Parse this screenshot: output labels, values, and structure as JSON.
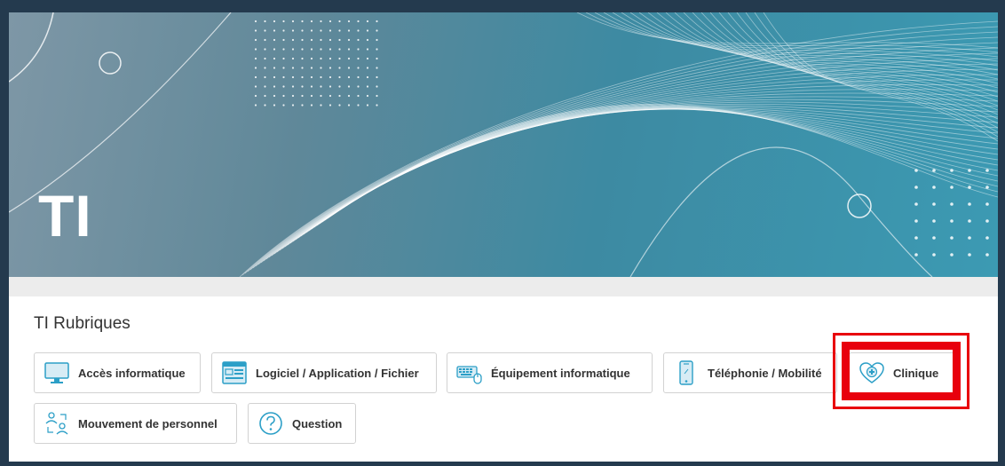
{
  "hero": {
    "title": "TI"
  },
  "rubriques": {
    "title": "TI Rubriques",
    "items": [
      {
        "label": "Accès informatique",
        "icon": "monitor-icon"
      },
      {
        "label": "Logiciel / Application / Fichier",
        "icon": "application-window-icon"
      },
      {
        "label": "Équipement informatique",
        "icon": "keyboard-mouse-icon"
      },
      {
        "label": "Téléphonie / Mobilité",
        "icon": "smartphone-icon"
      },
      {
        "label": "Clinique",
        "icon": "heart-plus-icon"
      },
      {
        "label": "Mouvement de personnel",
        "icon": "people-transfer-icon"
      },
      {
        "label": "Question",
        "icon": "question-circle-icon"
      }
    ]
  },
  "colors": {
    "accent": "#2c9fc7",
    "highlight": "#e8000d",
    "frame": "#243a4e"
  }
}
